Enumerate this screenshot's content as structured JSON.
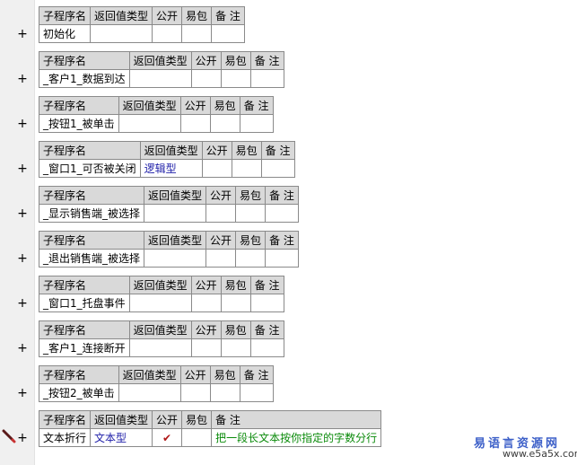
{
  "headers": {
    "name": "子程序名",
    "return_type": "返回值类型",
    "public": "公开",
    "easy_pack": "易包",
    "remark": "备 注"
  },
  "subroutines": [
    {
      "name": "初始化",
      "return_type": "",
      "public": false,
      "remark": ""
    },
    {
      "name": "_客户1_数据到达",
      "return_type": "",
      "public": false,
      "remark": ""
    },
    {
      "name": "_按钮1_被单击",
      "return_type": "",
      "public": false,
      "remark": ""
    },
    {
      "name": "_窗口1_可否被关闭",
      "return_type": "逻辑型",
      "public": false,
      "remark": ""
    },
    {
      "name": "_显示销售端_被选择",
      "return_type": "",
      "public": false,
      "remark": ""
    },
    {
      "name": "_退出销售端_被选择",
      "return_type": "",
      "public": false,
      "remark": ""
    },
    {
      "name": "_窗口1_托盘事件",
      "return_type": "",
      "public": false,
      "remark": ""
    },
    {
      "name": "_客户1_连接断开",
      "return_type": "",
      "public": false,
      "remark": ""
    },
    {
      "name": "_按钮2_被单击",
      "return_type": "",
      "public": false,
      "remark": ""
    },
    {
      "name": "文本折行",
      "return_type": "文本型",
      "public": true,
      "remark": "把一段长文本按你指定的字数分行"
    }
  ],
  "expand_symbol": "+",
  "check_symbol": "✔",
  "watermark": {
    "title": "易语言资源网",
    "url": "www.e5a5x.com"
  },
  "colors": {
    "header_bg": "#d9d9d9",
    "border": "#8a8a8a",
    "gutter_bg": "#f0f0f0",
    "type_text": "#1e1ea8",
    "remark_text": "#0a8a0a",
    "check": "#b01818",
    "watermark": "#3c5fc8"
  }
}
